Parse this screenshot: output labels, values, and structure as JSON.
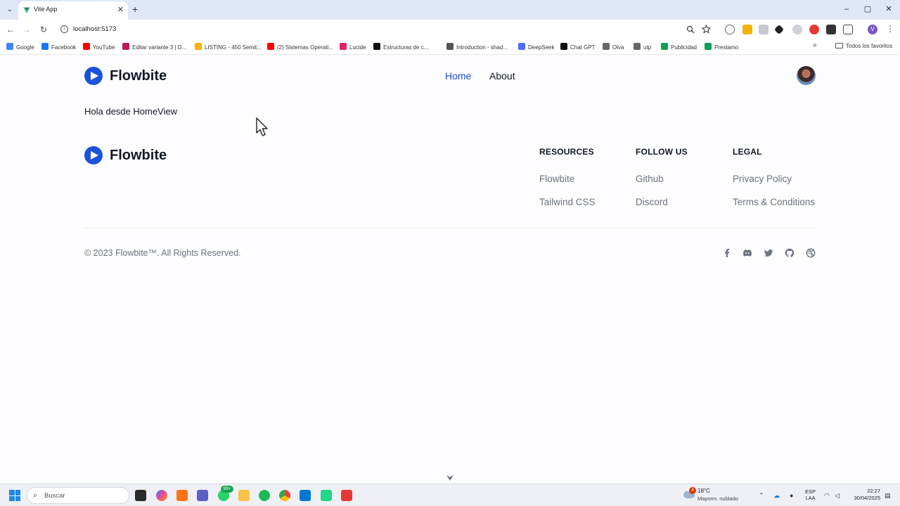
{
  "browser": {
    "tab_title": "Vite App",
    "tab_close": "✕",
    "new_tab": "+",
    "tab_list": "⌄",
    "url": "localhost:5173",
    "window_controls": {
      "minimize": "–",
      "restore": "▢",
      "close": "✕"
    },
    "nav": {
      "back": "←",
      "forward": "→",
      "reload": "↻"
    },
    "bookmarks": [
      {
        "label": "Google",
        "color": "#4285f4"
      },
      {
        "label": "Facebook",
        "color": "#1877f2"
      },
      {
        "label": "YouTube",
        "color": "#ff0000"
      },
      {
        "label": "Editar variante 3 | D...",
        "color": "#c2185b"
      },
      {
        "label": "LISTING - 450 Semit...",
        "color": "#f4b400"
      },
      {
        "label": "(2) Sistemas Operati...",
        "color": "#ff0000"
      },
      {
        "label": "Lucide",
        "color": "#e91e63"
      },
      {
        "label": "Estructuras de c...",
        "color": "#111111"
      },
      {
        "label": "Introduction - shad...",
        "color": "#555555"
      },
      {
        "label": "DeepSeek",
        "color": "#4d6bfe"
      },
      {
        "label": "Chat GPT",
        "color": "#111111"
      },
      {
        "label": "Olva",
        "color": "#666666"
      },
      {
        "label": "utp",
        "color": "#666666"
      },
      {
        "label": "Publicidad",
        "color": "#0f9d58"
      },
      {
        "label": "Prestamo",
        "color": "#0f9d58"
      }
    ],
    "bookmarks_more": "»",
    "all_bookmarks": "Todos los favoritos",
    "profile_initial": "V"
  },
  "page": {
    "brand_name": "Flowbite",
    "nav": {
      "home": "Home",
      "about": "About"
    },
    "hello": "Hola desde HomeView",
    "footer": {
      "brand_name": "Flowbite",
      "columns": [
        {
          "title": "RESOURCES",
          "links": [
            "Flowbite",
            "Tailwind CSS"
          ]
        },
        {
          "title": "FOLLOW US",
          "links": [
            "Github",
            "Discord"
          ]
        },
        {
          "title": "LEGAL",
          "links": [
            "Privacy Policy",
            "Terms & Conditions"
          ]
        }
      ],
      "copyright": "© 2023 Flowbite™. All Rights Reserved.",
      "social_icons": [
        "facebook-icon",
        "discord-icon",
        "twitter-icon",
        "github-icon",
        "dribbble-icon"
      ]
    },
    "accent_color": "#1d4ed8"
  },
  "taskbar": {
    "search_placeholder": "Buscar",
    "whatsapp_badge": "99+",
    "weather": {
      "badge": "4",
      "temp": "18°C",
      "desc": "Mayorm. nublado"
    },
    "language": {
      "line1": "ESP",
      "line2": "LAA"
    },
    "clock": {
      "time": "22:27",
      "date": "30/04/2025"
    }
  }
}
